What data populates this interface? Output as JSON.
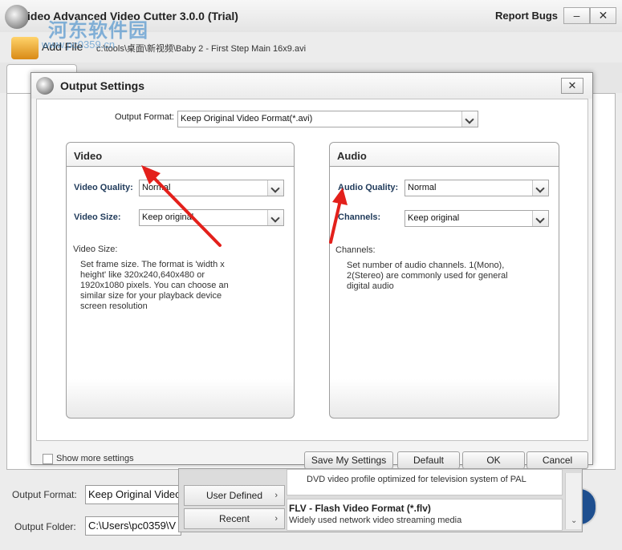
{
  "app": {
    "title": "ideo Advanced Video Cutter 3.0.0 (Trial)",
    "report_bugs": "Report Bugs",
    "minimize_icon": "minimize-icon",
    "close_icon": "close-icon",
    "watermark": "河东软件园",
    "watermark_url": "www.pc0359.cn"
  },
  "toolbar": {
    "add_file_label": "Add File",
    "file_path": "c:\\tools\\桌面\\新视频\\Baby 2 - First Step Main 16x9.avi"
  },
  "bottom": {
    "output_format_label": "Output Format:",
    "output_format_value": "Keep Original Video Format(*.avi)",
    "output_folder_label": "Output Folder:",
    "output_folder_value": "C:\\Users\\pc0359\\V"
  },
  "profile_popup": {
    "buttons": [
      {
        "label": "User Defined"
      },
      {
        "label": "Recent"
      }
    ],
    "items": [
      {
        "title": "",
        "desc": "DVD video profile optimized for television system of PAL"
      },
      {
        "title": "FLV - Flash Video Format (*.flv)",
        "desc": "Widely used network video streaming media"
      }
    ]
  },
  "dialog": {
    "title": "Output Settings",
    "output_format_label": "Output Format:",
    "output_format_value": "Keep Original Video Format(*.avi)",
    "video": {
      "heading": "Video",
      "quality_label": "Video Quality:",
      "quality_value": "Normal",
      "size_label": "Video Size:",
      "size_value": "Keep original",
      "desc_heading": "Video Size:",
      "desc_lines": [
        "Set frame size. The format is 'width x",
        "height' like 320x240,640x480 or",
        "1920x1080 pixels. You can choose an",
        "similar size for your playback device",
        "screen resolution"
      ]
    },
    "audio": {
      "heading": "Audio",
      "quality_label": "Audio Quality:",
      "quality_value": "Normal",
      "channels_label": "Channels:",
      "channels_value": "Keep original",
      "desc_heading": "Channels:",
      "desc_lines": [
        "Set number of audio channels. 1(Mono),",
        "2(Stereo) are commonly used for general",
        "digital audio"
      ]
    },
    "show_more_label": "Show more settings",
    "show_more_checked": false,
    "buttons": {
      "save": "Save My Settings",
      "default": "Default",
      "ok": "OK",
      "cancel": "Cancel"
    }
  },
  "annotation_color": "#e3201b"
}
